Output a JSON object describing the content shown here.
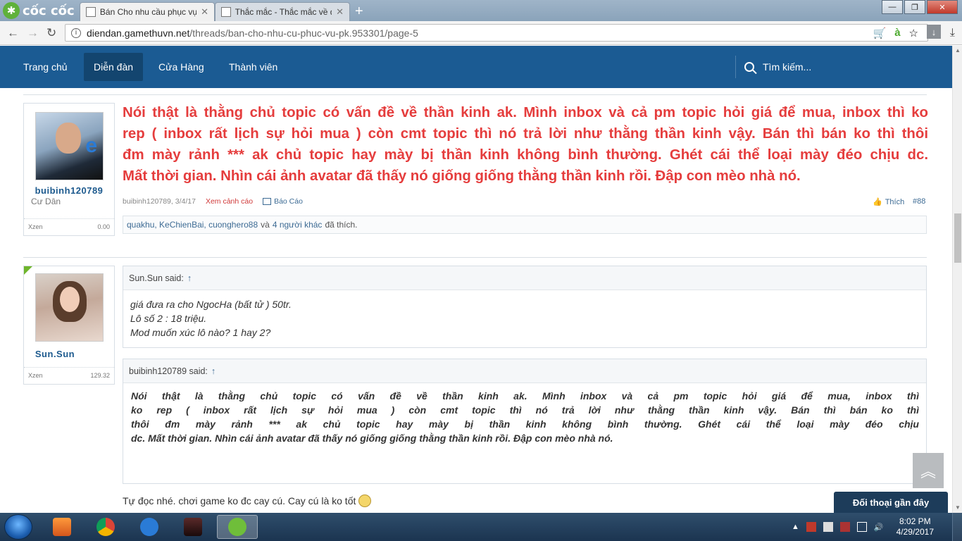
{
  "browser": {
    "logo_text": "cốc cốc",
    "tabs": [
      {
        "title": "Bán Cho nhu cầu phục vụ"
      },
      {
        "title": "Thắc mắc - Thắc mắc về q"
      }
    ],
    "url_host": "diendan.gamethuvn.net",
    "url_path": "/threads/ban-cho-nhu-cu-phuc-vu-pk.953301/page-5"
  },
  "nav": {
    "items": [
      "Trang chủ",
      "Diễn đàn",
      "Cửa Hàng",
      "Thành viên"
    ],
    "active": "Diễn đàn",
    "search_label": "Tìm kiếm..."
  },
  "post1": {
    "user": {
      "name": "buibinh120789",
      "title": "Cư Dân",
      "xzen_label": "Xzen",
      "xzen_value": "0.00"
    },
    "lines": [
      "Nói thật là thằng chủ topic có vấn đề về thần kinh ak. Mình inbox và cả pm topic hỏi giá để mua, inbox thì ko",
      "rep ( inbox rất lịch sự hỏi mua ) còn cmt topic thì nó trả lời như thằng thần kinh vậy. Bán thì bán ko thì thôi",
      "đm mày rảnh *** ak chủ topic hay mày bị thần kinh không bình thường. Ghét cái thể loại mày đéo chịu dc.",
      "Mất thời gian. Nhìn cái ảnh avatar đã thấy nó giống giống thằng thần kinh rồi. Đập con mèo nhà nó."
    ],
    "meta_author_date": "buibinh120789, 3/4/17",
    "meta_warn": "Xem cảnh cáo",
    "meta_report": "Báo Cáo",
    "like_label": "Thích",
    "post_number": "#88",
    "likes": {
      "users": "quakhu, KeChienBai, cuonghero88",
      "and": "và",
      "others": "4 người khác",
      "suffix": "đã thích."
    }
  },
  "post2": {
    "user": {
      "name": "Sun.Sun",
      "xzen_label": "Xzen",
      "xzen_value": "129.32"
    },
    "quote1": {
      "head": "Sun.Sun said:",
      "lines": [
        "giá đưa ra cho NgocHa (bất tử ) 50tr.",
        "Lô số 2 : 18 triệu.",
        "Mod muốn xúc lô nào? 1 hay 2?"
      ]
    },
    "quote2": {
      "head": "buibinh120789 said:",
      "lines": [
        "Nói thật là thằng chủ topic có vấn đề về thần kinh ak. Mình inbox và cả pm topic hỏi giá để mua, inbox thì",
        "ko rep ( inbox rất lịch sự hỏi mua ) còn cmt topic thì nó trả lời như thằng thần kinh vậy. Bán thì bán ko thì",
        "thôi đm mày rảnh *** ak chủ topic hay mày bị thần kinh không bình thường. Ghét cái thể loại mày đéo chịu",
        "dc. Mất thời gian. Nhìn cái ảnh avatar đã thấy nó giống giống thằng thần kinh rồi. Đập con mèo nhà nó."
      ]
    },
    "reply_text": "Tự đọc nhé. chơi game ko đc cay cú. Cay cú là ko tốt"
  },
  "widgets": {
    "chat_label": "Đối thoại gần đây",
    "scroll_top_icon": "double-chevron-up"
  },
  "taskbar": {
    "time": "8:02 PM",
    "date": "4/29/2017"
  },
  "colors": {
    "nav_bg": "#1b5b93",
    "post_red": "#e53d3d",
    "link_blue": "#3d6b94"
  }
}
